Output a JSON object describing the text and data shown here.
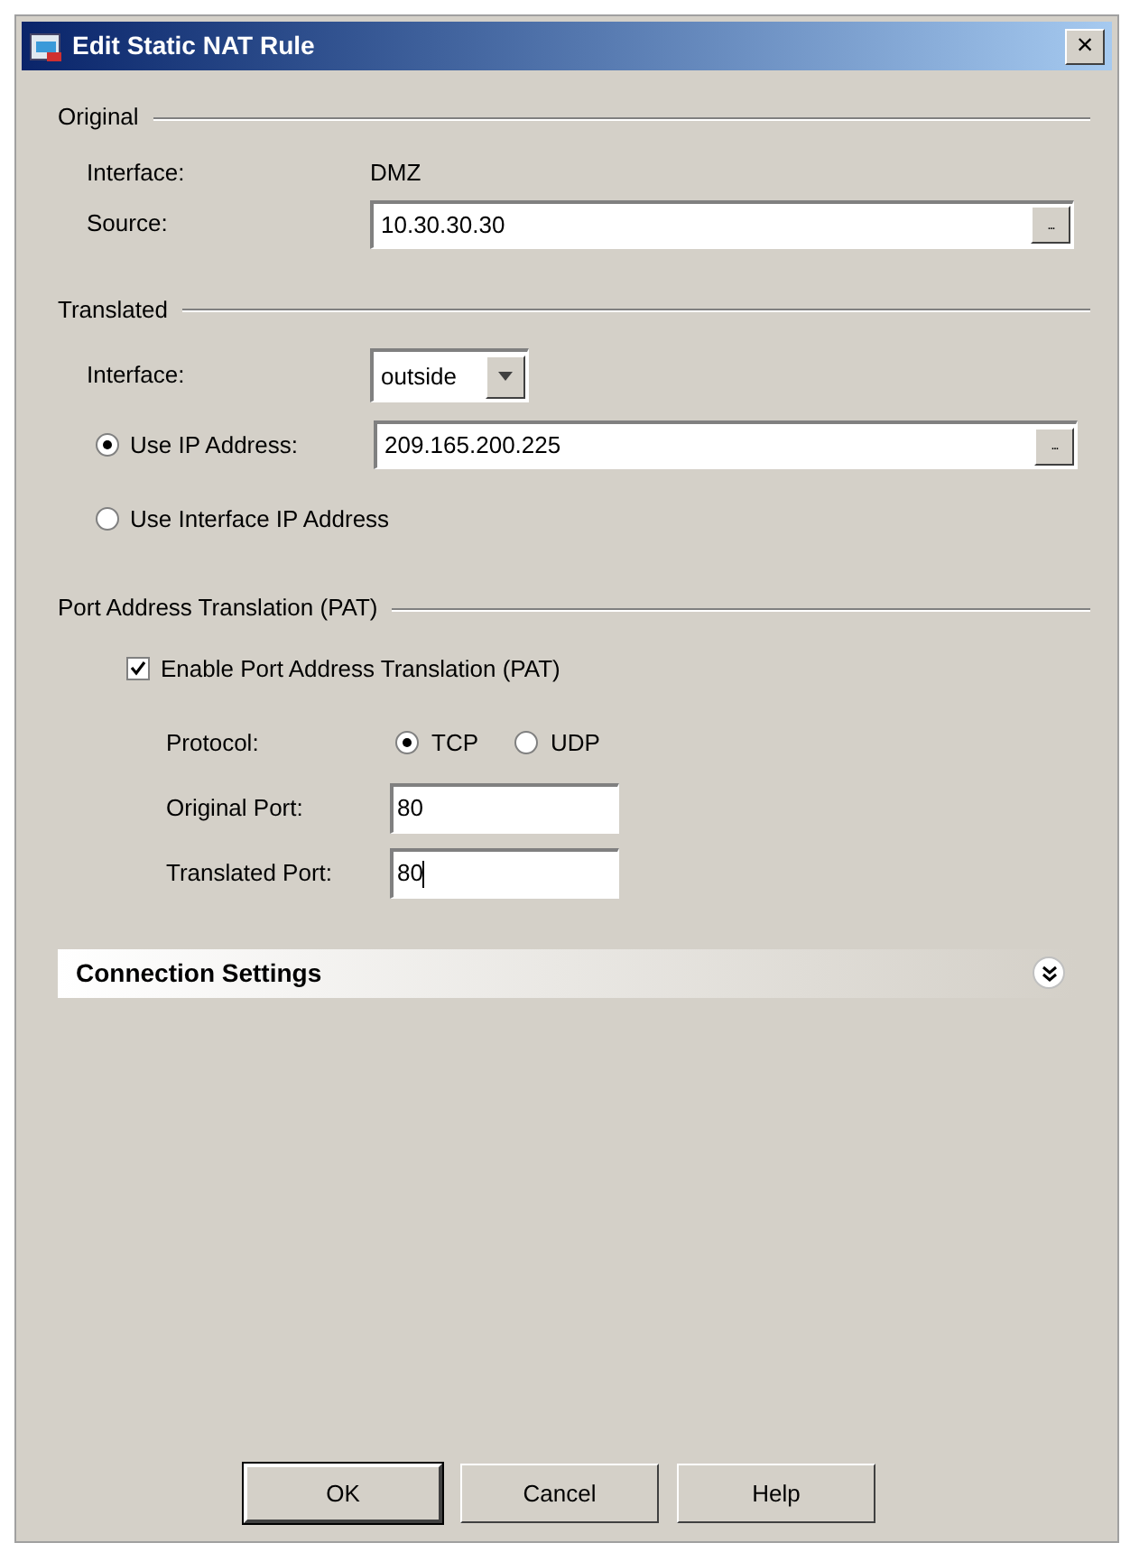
{
  "window": {
    "title": "Edit Static NAT Rule",
    "close": "×"
  },
  "original": {
    "heading": "Original",
    "interface_label": "Interface:",
    "interface_value": "DMZ",
    "source_label": "Source:",
    "source_value": "10.30.30.30",
    "browse": "..."
  },
  "translated": {
    "heading": "Translated",
    "interface_label": "Interface:",
    "interface_value": "outside",
    "options": [
      {
        "label": "Use IP Address:",
        "selected": true,
        "value": "209.165.200.225",
        "browse": "..."
      },
      {
        "label": "Use Interface IP Address",
        "selected": false
      }
    ]
  },
  "pat": {
    "heading": "Port Address Translation (PAT)",
    "enable": {
      "label": "Enable Port Address Translation (PAT)",
      "checked": true
    },
    "protocol_label": "Protocol:",
    "protocols": [
      {
        "label": "TCP",
        "selected": true
      },
      {
        "label": "UDP",
        "selected": false
      }
    ],
    "ports": [
      {
        "label": "Original Port:",
        "value": "80",
        "focused": false
      },
      {
        "label": "Translated Port:",
        "value": "80",
        "focused": true
      }
    ]
  },
  "connection_settings": {
    "title": "Connection Settings",
    "expanded": false
  },
  "buttons": [
    {
      "label": "OK",
      "default": true
    },
    {
      "label": "Cancel",
      "default": false
    },
    {
      "label": "Help",
      "default": false
    }
  ]
}
